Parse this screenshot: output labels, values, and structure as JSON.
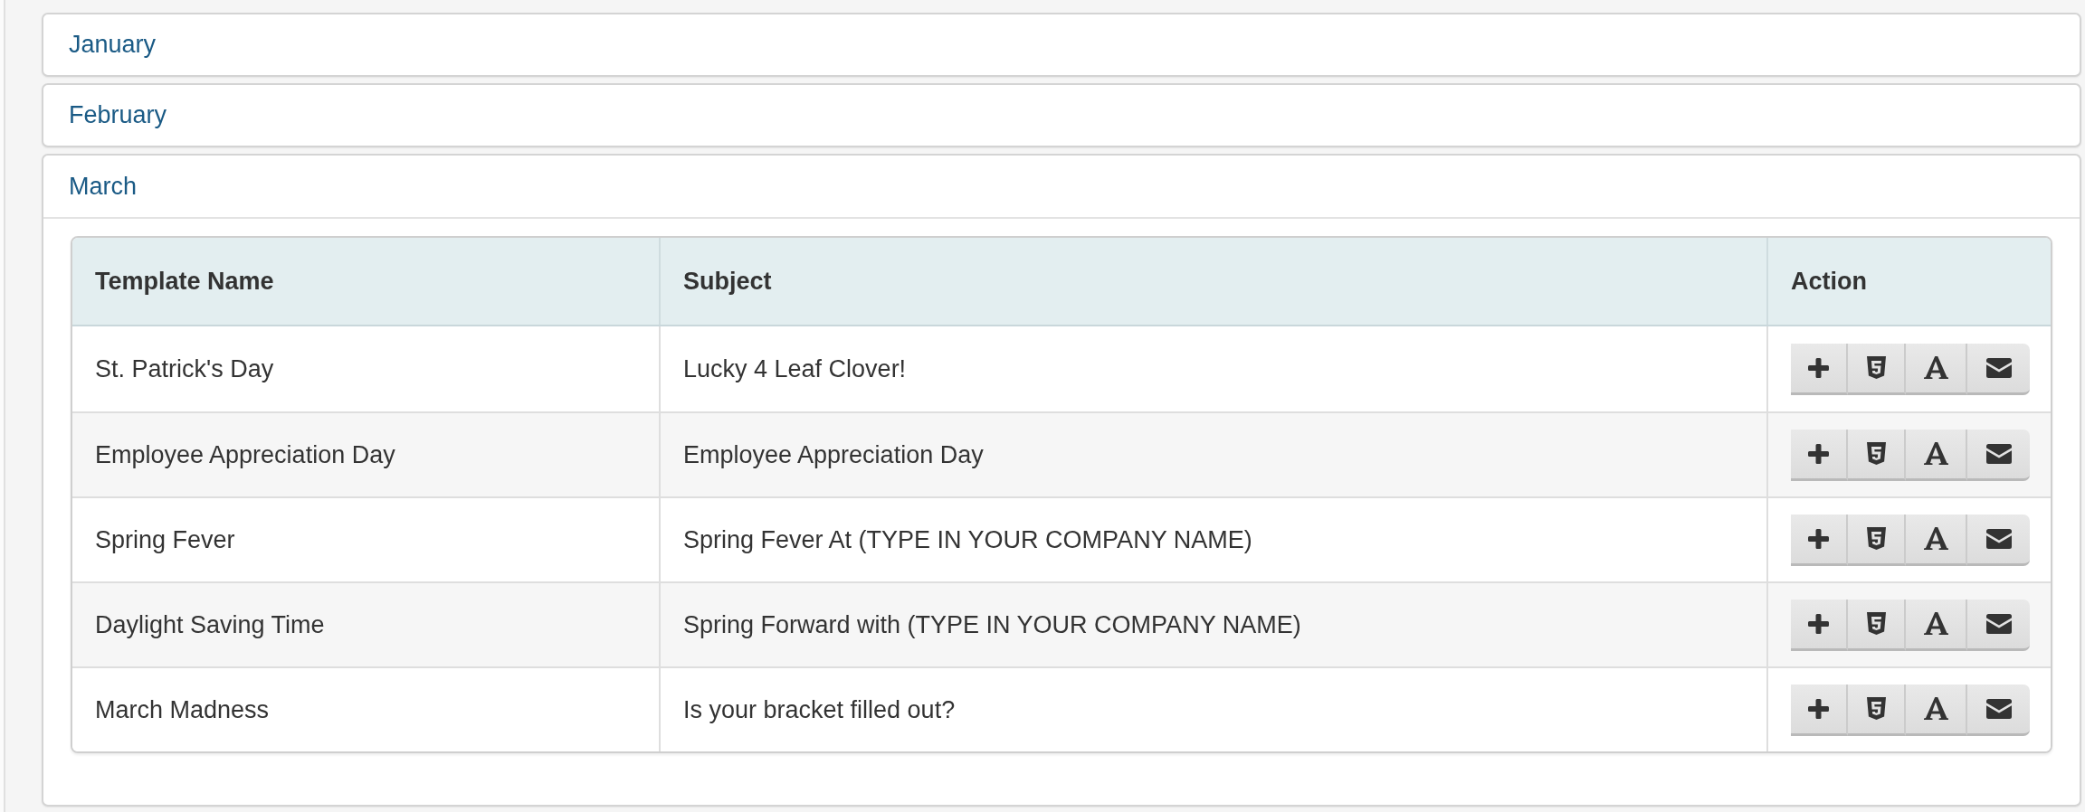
{
  "panels": [
    {
      "title": "January",
      "expanded": false
    },
    {
      "title": "February",
      "expanded": false
    },
    {
      "title": "March",
      "expanded": true,
      "table": {
        "columns": [
          "Template Name",
          "Subject",
          "Action"
        ],
        "rows": [
          {
            "template_name": "St. Patrick's Day",
            "subject": "Lucky 4 Leaf Clover!"
          },
          {
            "template_name": "Employee Appreciation Day",
            "subject": "Employee Appreciation Day"
          },
          {
            "template_name": "Spring Fever",
            "subject": "Spring Fever At (TYPE IN YOUR COMPANY NAME)"
          },
          {
            "template_name": "Daylight Saving Time",
            "subject": "Spring Forward with (TYPE IN YOUR COMPANY NAME)"
          },
          {
            "template_name": "March Madness",
            "subject": "Is your bracket filled out?"
          }
        ]
      }
    }
  ]
}
